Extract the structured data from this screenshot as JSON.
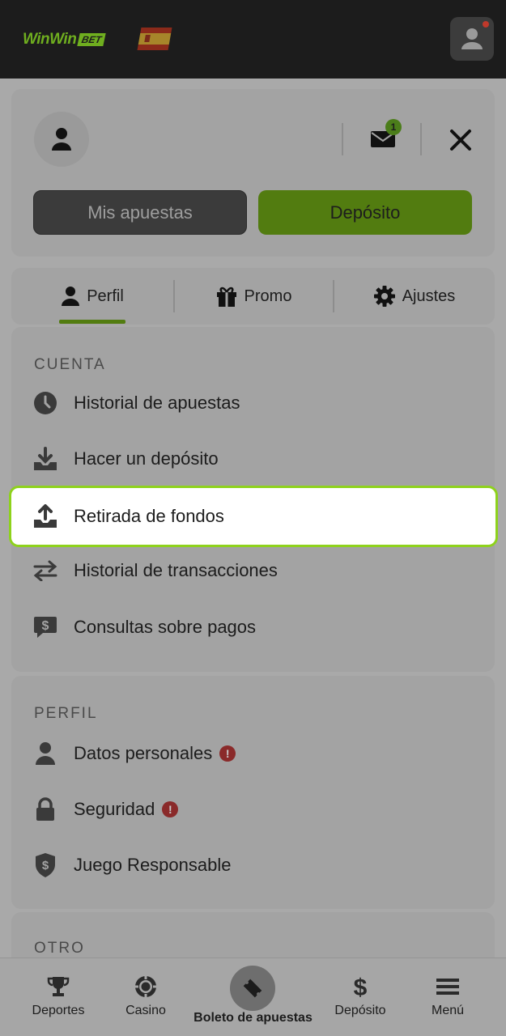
{
  "header": {
    "logo_text": "WinWin",
    "logo_badge": "BET",
    "flag_icon": "spain-flag-icon",
    "avatar_icon": "user-icon",
    "notification_dot_color": "#c0392b"
  },
  "profile": {
    "mail_badge_count": "1",
    "my_bets_label": "Mis apuestas",
    "deposit_label": "Depósito"
  },
  "tabs": [
    {
      "label": "Perfil",
      "icon": "user-icon",
      "active": true
    },
    {
      "label": "Promo",
      "icon": "gift-icon",
      "active": false
    },
    {
      "label": "Ajustes",
      "icon": "gear-icon",
      "active": false
    }
  ],
  "sections": {
    "cuenta": {
      "title": "CUENTA",
      "items": [
        {
          "label": "Historial de apuestas",
          "icon": "clock-icon"
        },
        {
          "label": "Hacer un depósito",
          "icon": "download-tray-icon"
        },
        {
          "label": "Retirada de fondos",
          "icon": "upload-tray-icon",
          "highlighted": true
        },
        {
          "label": "Historial de transacciones",
          "icon": "swap-arrows-icon"
        },
        {
          "label": "Consultas sobre pagos",
          "icon": "dollar-chat-icon"
        }
      ]
    },
    "perfil": {
      "title": "PERFIL",
      "items": [
        {
          "label": "Datos personales",
          "icon": "user-icon",
          "warning": "!"
        },
        {
          "label": "Seguridad",
          "icon": "lock-icon",
          "warning": "!"
        },
        {
          "label": "Juego Responsable",
          "icon": "shield-dollar-icon"
        }
      ]
    },
    "otro": {
      "title": "OTRO"
    }
  },
  "bottom_nav": [
    {
      "label": "Deportes",
      "icon": "trophy-icon"
    },
    {
      "label": "Casino",
      "icon": "casino-chip-icon"
    },
    {
      "label": "Boleto de apuestas",
      "icon": "ticket-icon"
    },
    {
      "label": "Depósito",
      "icon": "dollar-icon"
    },
    {
      "label": "Menú",
      "icon": "hamburger-icon"
    }
  ],
  "colors": {
    "accent_green": "#8ed21c",
    "deposit_button": "#527c10",
    "warning_red": "#8a2a2a"
  }
}
